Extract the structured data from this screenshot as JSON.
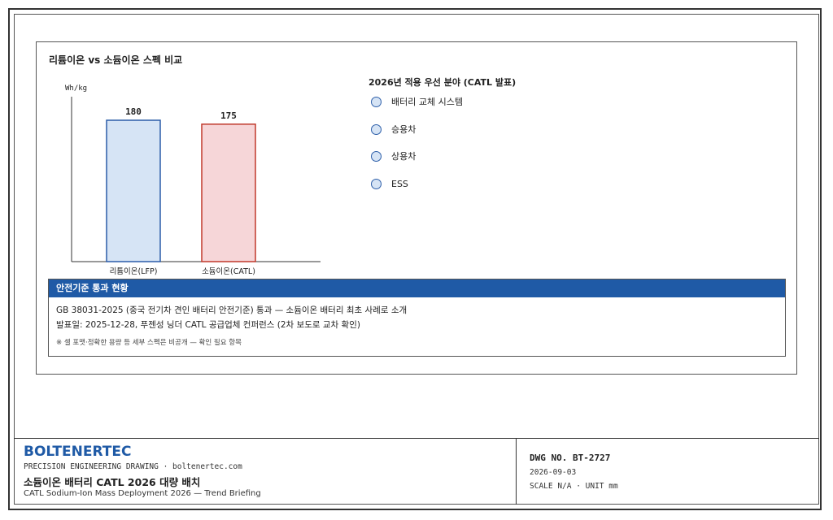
{
  "chart": {
    "title": "리튬이온 vs 소듐이온 스펙 비교"
  },
  "chart_data": {
    "type": "bar",
    "title": "리튬이온 vs 소듐이온 스펙 비교",
    "ylabel": "Wh/kg",
    "xlabel": "",
    "categories": [
      "리튬이온(LFP)",
      "소듐이온(CATL)"
    ],
    "values": [
      180,
      175
    ],
    "ylim": [
      0,
      210
    ],
    "grid": false,
    "bar_colors": [
      {
        "fill": "#d6e4f5",
        "stroke": "#2b5da8"
      },
      {
        "fill": "#f6d6d8",
        "stroke": "#c0392b"
      }
    ]
  },
  "priority": {
    "title": "2026년 적용 우선 분야 (CATL 발표)",
    "items": [
      "배터리 교체 시스템",
      "승용차",
      "상용차",
      "ESS"
    ]
  },
  "safety": {
    "header": "안전기준 통과 현황",
    "line1": "GB 38031-2025 (중국 전기차 견인 배터리 안전기준) 통과 — 소듐이온 배터리 최초 사례로 소개",
    "line2": "발표일: 2025-12-28, 푸젠성 닝더 CATL 공급업체 컨퍼런스 (2차 보도로 교차 확인)",
    "note": "※ 셀 포맷·정확한 용량 등 세부 스펙은 비공개 — 확인 필요 항목"
  },
  "title_block": {
    "company": "BOLTENERTEC",
    "tagline": "PRECISION ENGINEERING DRAWING · boltenertec.com",
    "doc_title_ko": "소듐이온 배터리 CATL 2026 대량 배치",
    "doc_title_en": "CATL Sodium-Ion Mass Deployment 2026 — Trend Briefing",
    "dwg_no": "DWG NO. BT-2727",
    "date": "2026-09-03",
    "scale": "SCALE N/A · UNIT mm"
  },
  "colors": {
    "accent": "#1f5aa6",
    "radio_fill": "#d6e4f5",
    "radio_stroke": "#2b5da8"
  }
}
